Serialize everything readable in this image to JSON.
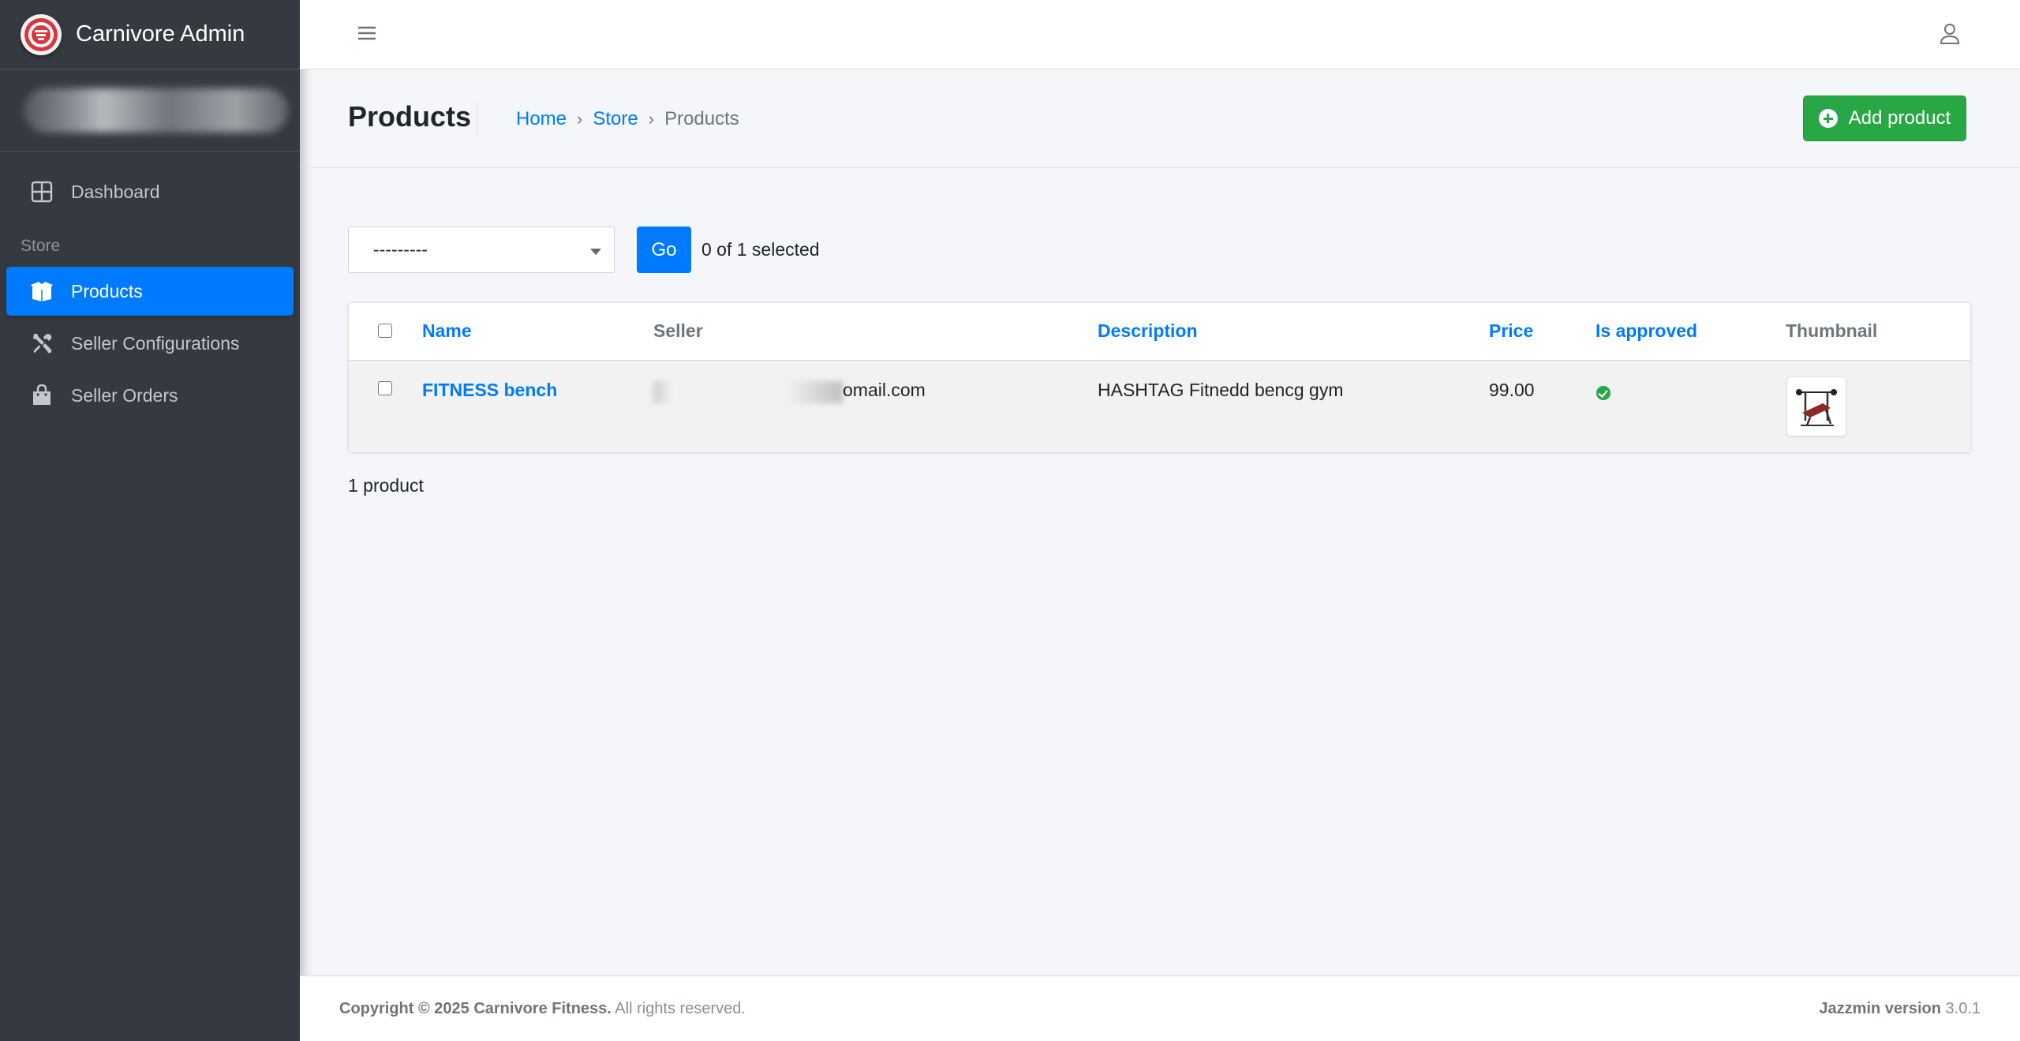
{
  "brand": {
    "name": "Carnivore Admin"
  },
  "sidebar": {
    "items": [
      {
        "label": "Dashboard",
        "icon": "grid-icon"
      },
      {
        "label": "Products",
        "icon": "box-icon",
        "active": true
      },
      {
        "label": "Seller Configurations",
        "icon": "tools-icon"
      },
      {
        "label": "Seller Orders",
        "icon": "shopping-bag-icon"
      }
    ],
    "section_store": "Store"
  },
  "header": {
    "title": "Products",
    "breadcrumb": [
      "Home",
      "Store",
      "Products"
    ],
    "add_button": "Add product"
  },
  "actions": {
    "select_value": "---------",
    "go_label": "Go",
    "selected_text": "0 of 1 selected"
  },
  "table": {
    "columns": [
      "Name",
      "Seller",
      "Description",
      "Price",
      "Is approved",
      "Thumbnail"
    ],
    "rows": [
      {
        "name": "FITNESS bench",
        "seller": "omail.com",
        "description": "HASHTAG Fitnedd bencg gym",
        "price": "99.00",
        "approved": true
      }
    ]
  },
  "summary": "1 product",
  "footer": {
    "copyright_bold": "Copyright © 2025 Carnivore Fitness.",
    "copyright_rest": " All rights reserved.",
    "version_bold": "Jazzmin version",
    "version": " 3.0.1"
  },
  "colors": {
    "sidebar": "#343a40",
    "primary": "#007bff",
    "success": "#28a745"
  }
}
